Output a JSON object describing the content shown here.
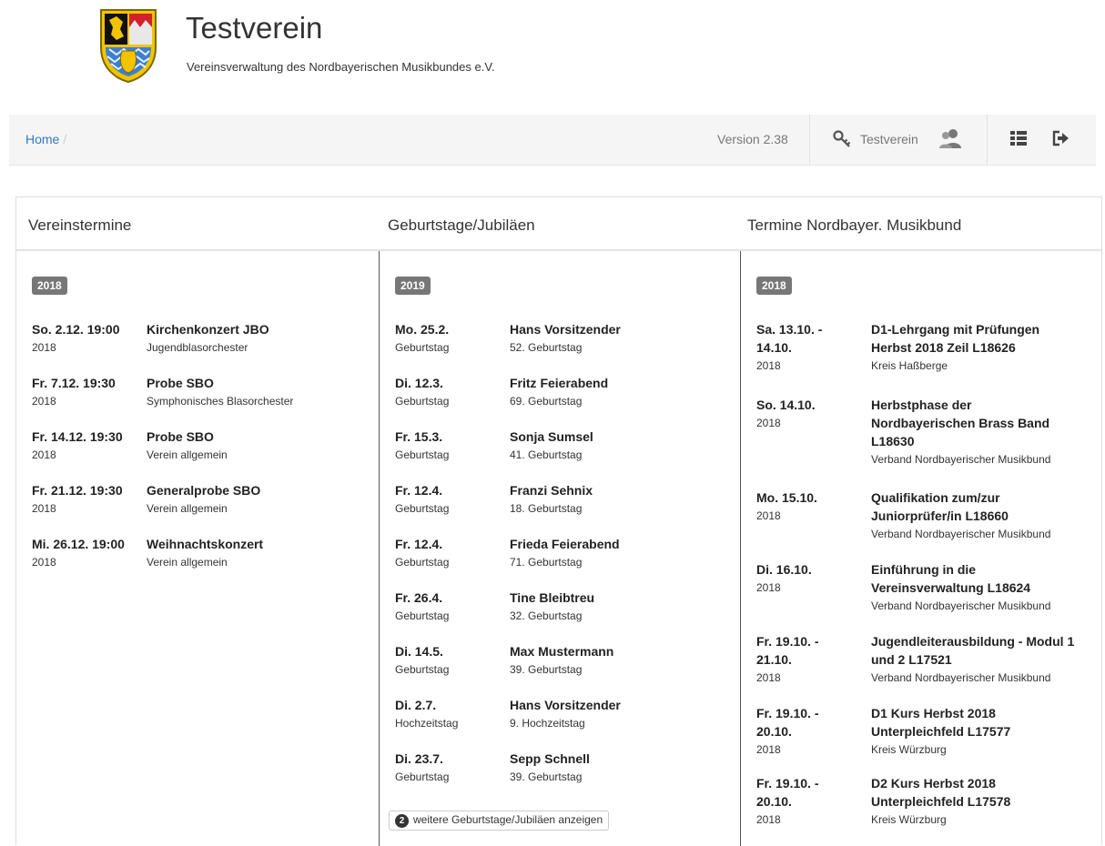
{
  "header": {
    "title": "Testverein",
    "subtitle": "Vereinsverwaltung des Nordbayerischen Musikbundes e.V."
  },
  "nav": {
    "breadcrumb_home": "Home",
    "breadcrumb_sep": "/",
    "version": "Version 2.38",
    "user": "Testverein"
  },
  "columns": {
    "vereinstermine": {
      "title": "Vereinstermine",
      "year": "2018",
      "items": [
        {
          "date": "So. 2.12. 19:00",
          "year": "2018",
          "title": "Kirchenkonzert JBO",
          "sub": "Jugendblasorchester"
        },
        {
          "date": "Fr. 7.12. 19:30",
          "year": "2018",
          "title": "Probe SBO",
          "sub": "Symphonisches Blasorchester"
        },
        {
          "date": "Fr. 14.12. 19:30",
          "year": "2018",
          "title": "Probe SBO",
          "sub": "Verein allgemein"
        },
        {
          "date": "Fr. 21.12. 19:30",
          "year": "2018",
          "title": "Generalprobe SBO",
          "sub": "Verein allgemein"
        },
        {
          "date": "Mi. 26.12. 19:00",
          "year": "2018",
          "title": "Weihnachtskonzert",
          "sub": "Verein allgemein"
        }
      ]
    },
    "geburtstage": {
      "title": "Geburtstage/Jubiläen",
      "year": "2019",
      "items": [
        {
          "date": "Mo. 25.2.",
          "type": "Geburtstag",
          "name": "Hans Vorsitzender",
          "sub": "52. Geburtstag"
        },
        {
          "date": "Di. 12.3.",
          "type": "Geburtstag",
          "name": "Fritz Feierabend",
          "sub": "69. Geburtstag"
        },
        {
          "date": "Fr. 15.3.",
          "type": "Geburtstag",
          "name": "Sonja Sumsel",
          "sub": "41. Geburtstag"
        },
        {
          "date": "Fr. 12.4.",
          "type": "Geburtstag",
          "name": "Franzi Sehnix",
          "sub": "18. Geburtstag"
        },
        {
          "date": "Fr. 12.4.",
          "type": "Geburtstag",
          "name": "Frieda Feierabend",
          "sub": "71. Geburtstag"
        },
        {
          "date": "Fr. 26.4.",
          "type": "Geburtstag",
          "name": "Tine Bleibtreu",
          "sub": "32. Geburtstag"
        },
        {
          "date": "Di. 14.5.",
          "type": "Geburtstag",
          "name": "Max Mustermann",
          "sub": "39. Geburtstag"
        },
        {
          "date": "Di. 2.7.",
          "type": "Hochzeitstag",
          "name": "Hans Vorsitzender",
          "sub": "9. Hochzeitstag"
        },
        {
          "date": "Di. 23.7.",
          "type": "Geburtstag",
          "name": "Sepp Schnell",
          "sub": "39. Geburtstag"
        }
      ],
      "more_count": "2",
      "more_label": "weitere Geburtstage/Jubiläen anzeigen"
    },
    "nbmb": {
      "title": "Termine Nordbayer. Musikbund",
      "year": "2018",
      "items": [
        {
          "date1": "Sa. 13.10. -",
          "date2": "14.10.",
          "year": "2018",
          "t1": "D1-Lehrgang mit Prüfungen",
          "t2": "Herbst 2018 Zeil L18626",
          "t3": "",
          "sub": "Kreis Haßberge"
        },
        {
          "date1": "So. 14.10.",
          "date2": "",
          "year": "2018",
          "t1": "Herbstphase der",
          "t2": "Nordbayerischen Brass Band",
          "t3": "L18630",
          "sub": "Verband Nordbayerischer Musikbund"
        },
        {
          "date1": "Mo. 15.10.",
          "date2": "",
          "year": "2018",
          "t1": "Qualifikation zum/zur",
          "t2": "Juniorprüfer/in L18660",
          "t3": "",
          "sub": "Verband Nordbayerischer Musikbund"
        },
        {
          "date1": "Di. 16.10.",
          "date2": "",
          "year": "2018",
          "t1": "Einführung in die",
          "t2": "Vereinsverwaltung L18624",
          "t3": "",
          "sub": "Verband Nordbayerischer Musikbund"
        },
        {
          "date1": "Fr. 19.10. -",
          "date2": "21.10.",
          "year": "2018",
          "t1": "Jugendleiterausbildung - Modul 1",
          "t2": "und 2 L17521",
          "t3": "",
          "sub": "Verband Nordbayerischer Musikbund"
        },
        {
          "date1": "Fr. 19.10. -",
          "date2": "20.10.",
          "year": "2018",
          "t1": "D1 Kurs Herbst 2018",
          "t2": "Unterpleichfeld L17577",
          "t3": "",
          "sub": "Kreis Würzburg"
        },
        {
          "date1": "Fr. 19.10. -",
          "date2": "20.10.",
          "year": "2018",
          "t1": "D2 Kurs Herbst 2018",
          "t2": "Unterpleichfeld L17578",
          "t3": "",
          "sub": "Kreis Würzburg"
        }
      ]
    }
  }
}
